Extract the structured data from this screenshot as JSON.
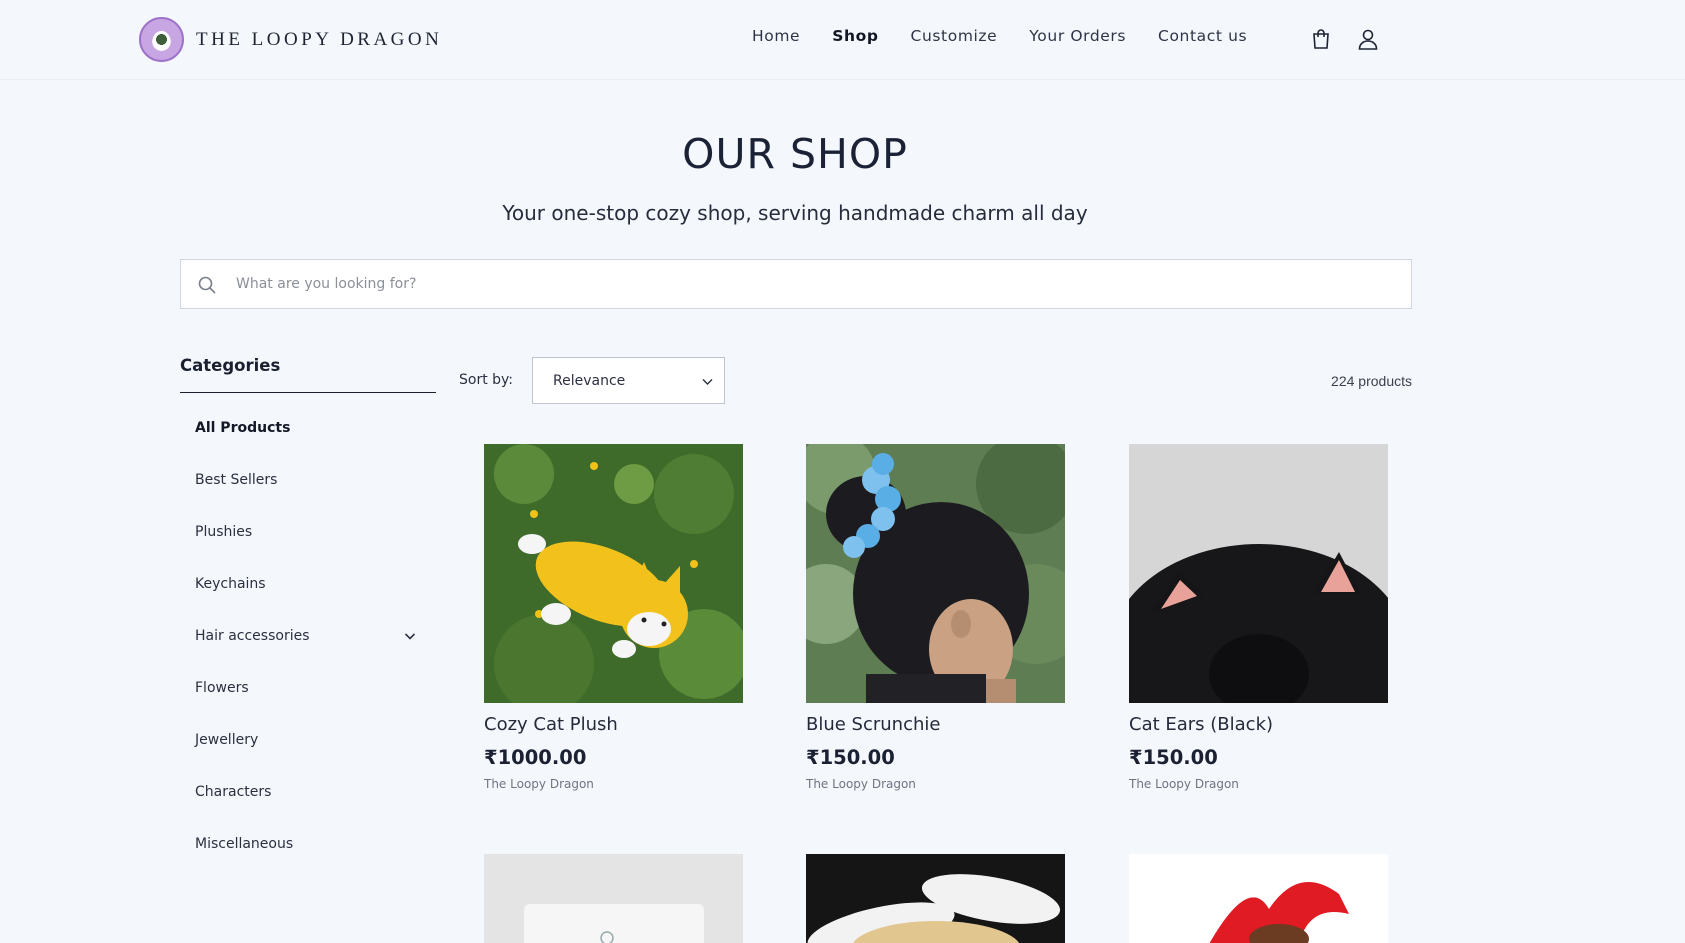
{
  "header": {
    "brand": "THE LOOPY DRAGON",
    "nav": [
      {
        "label": "Home",
        "active": false
      },
      {
        "label": "Shop",
        "active": true
      },
      {
        "label": "Customize",
        "active": false
      },
      {
        "label": "Your Orders",
        "active": false
      },
      {
        "label": "Contact us",
        "active": false
      }
    ],
    "icons": [
      "bag-icon",
      "user-icon"
    ]
  },
  "hero": {
    "title": "OUR SHOP",
    "subtitle": "Your one-stop cozy shop, serving handmade charm all day"
  },
  "search": {
    "placeholder": "What are you looking for?",
    "value": ""
  },
  "sidebar": {
    "heading": "Categories",
    "items": [
      {
        "label": "All Products",
        "active": true
      },
      {
        "label": "Best Sellers"
      },
      {
        "label": "Plushies"
      },
      {
        "label": "Keychains"
      },
      {
        "label": "Hair accessories",
        "expandable": true
      },
      {
        "label": "Flowers"
      },
      {
        "label": "Jewellery"
      },
      {
        "label": "Characters"
      },
      {
        "label": "Miscellaneous"
      }
    ]
  },
  "toolbar": {
    "sort_label": "Sort by:",
    "sort_value": "Relevance",
    "count": "224 products"
  },
  "products": [
    {
      "name": "Cozy Cat Plush",
      "price": "₹1000.00",
      "vendor": "The Loopy Dragon"
    },
    {
      "name": "Blue Scrunchie",
      "price": "₹150.00",
      "vendor": "The Loopy Dragon"
    },
    {
      "name": "Cat Ears (Black)",
      "price": "₹150.00",
      "vendor": "The Loopy Dragon"
    }
  ],
  "colors": {
    "background": "#f4f7fc",
    "text": "#1d2333",
    "logo_accent": "#c7a6e3"
  }
}
